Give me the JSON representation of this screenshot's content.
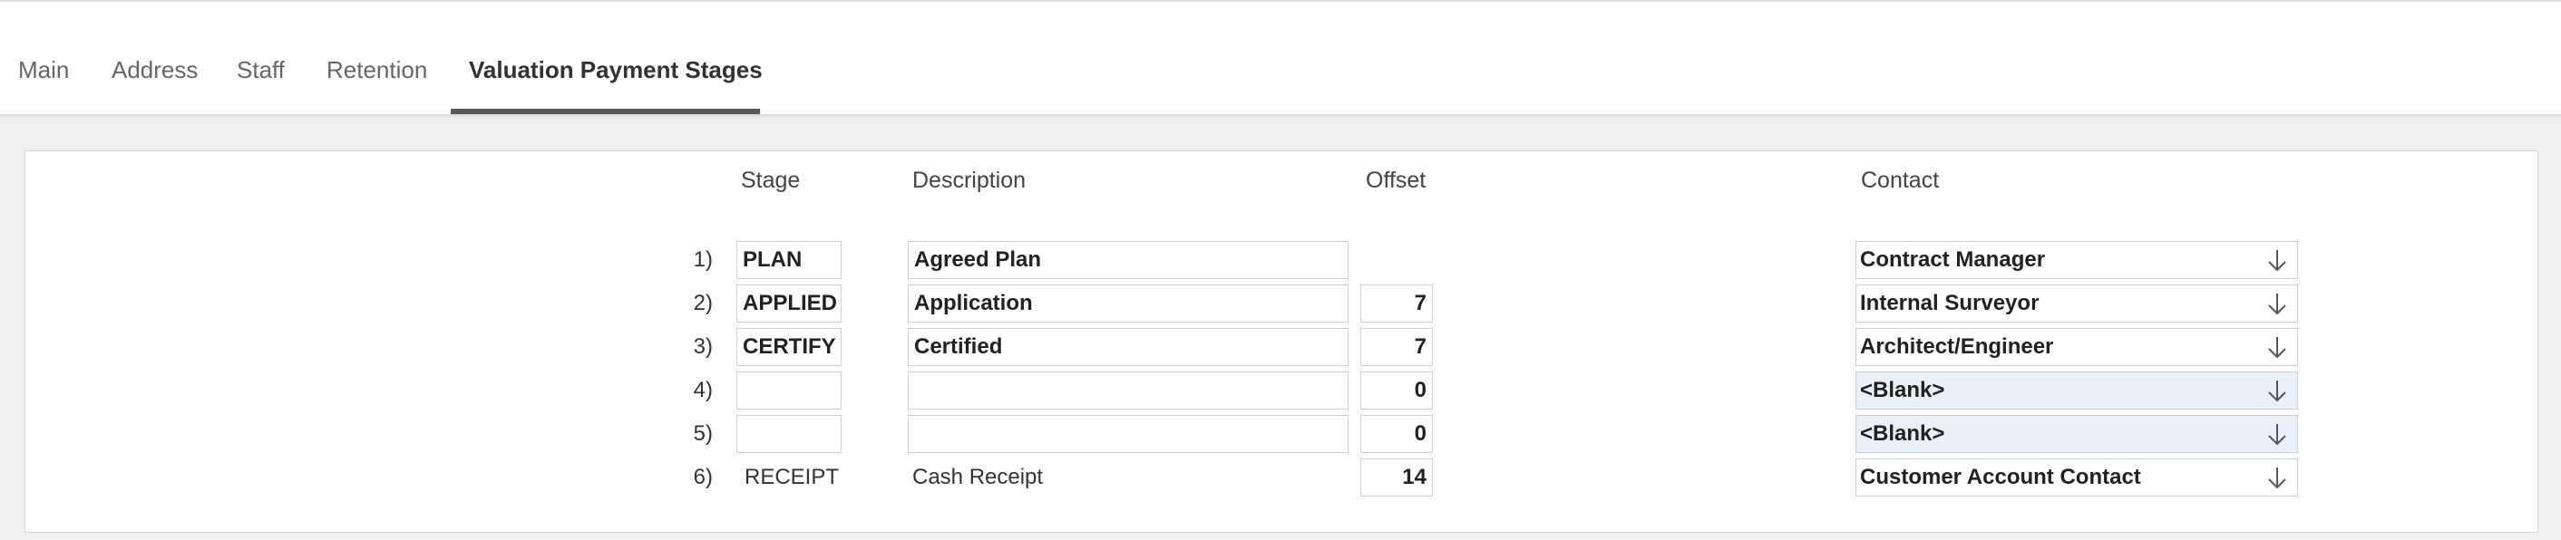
{
  "tabs": [
    {
      "label": "Main"
    },
    {
      "label": "Address"
    },
    {
      "label": "Staff"
    },
    {
      "label": "Retention"
    },
    {
      "label": "Valuation Payment Stages"
    }
  ],
  "active_tab": "Valuation Payment Stages",
  "headers": {
    "stage": "Stage",
    "description": "Description",
    "offset": "Offset",
    "contact": "Contact"
  },
  "rows": [
    {
      "num": "1)",
      "stage": "PLAN",
      "description": "Agreed Plan",
      "offset": "",
      "contact": "Contract Manager"
    },
    {
      "num": "2)",
      "stage": "APPLIED",
      "description": "Application",
      "offset": "7",
      "contact": "Internal Surveyor"
    },
    {
      "num": "3)",
      "stage": "CERTIFY",
      "description": "Certified",
      "offset": "7",
      "contact": "Architect/Engineer"
    },
    {
      "num": "4)",
      "stage": "",
      "description": "",
      "offset": "0",
      "contact": "<Blank>"
    },
    {
      "num": "5)",
      "stage": "",
      "description": "",
      "offset": "0",
      "contact": "<Blank>"
    },
    {
      "num": "6)",
      "stage": "RECEIPT",
      "description": "Cash Receipt",
      "offset": "14",
      "contact": "Customer Account Contact"
    }
  ],
  "icons": {
    "dropdown": "arrow-down-icon"
  },
  "colors": {
    "active_tab_underline": "#5a5a5a",
    "blank_select_bg": "#eaf0f8",
    "page_bg": "#f0f0f0"
  }
}
